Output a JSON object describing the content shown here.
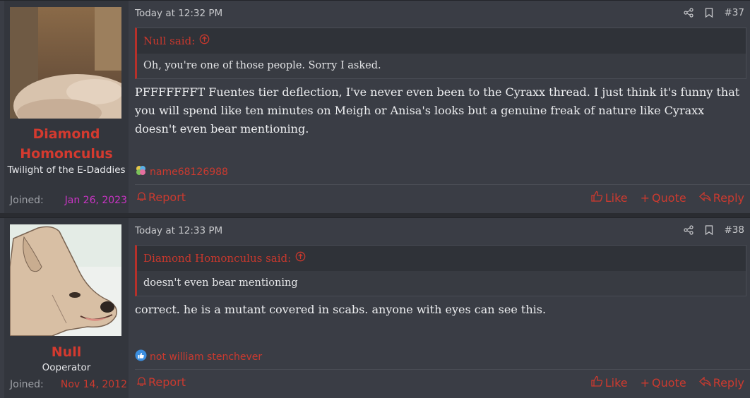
{
  "posts": [
    {
      "username": "Diamond Homonculus",
      "user_title": "Twilight of the E-Daddies",
      "joined_label": "Joined:",
      "joined_date": "Jan 26, 2023",
      "joined_color": "#c934c4",
      "timestamp": "Today at 12:32 PM",
      "number": "#37",
      "quote_author": "Null said:",
      "quote_text": "Oh, you're one of those people. Sorry I asked.",
      "body": "PFFFFFFFT Fuentes tier deflection, I've never even been to the Cyraxx thread. I just think it's funny that you will spend like ten minutes on Meigh or Anisa's looks but a genuine freak of nature like Cyraxx doesn't even bear mentioning.",
      "reaction_icon": "colorful-reaction-icon",
      "reaction_user": "name68126988",
      "report": "Report",
      "like": "Like",
      "quote": "Quote",
      "reply": "Reply"
    },
    {
      "username": "Null",
      "user_title": "Ooperator",
      "joined_label": "Joined:",
      "joined_date": "Nov 14, 2012",
      "joined_color": "#cc3a2f",
      "timestamp": "Today at 12:33 PM",
      "number": "#38",
      "quote_author": "Diamond Homonculus said:",
      "quote_text": "doesn't even bear mentioning",
      "body": "correct. he is a mutant covered in scabs. anyone with eyes can see this.",
      "reaction_icon": "thumbs-up-reaction-icon",
      "reaction_user": "not william stenchever",
      "report": "Report",
      "like": "Like",
      "quote": "Quote",
      "reply": "Reply"
    }
  ]
}
